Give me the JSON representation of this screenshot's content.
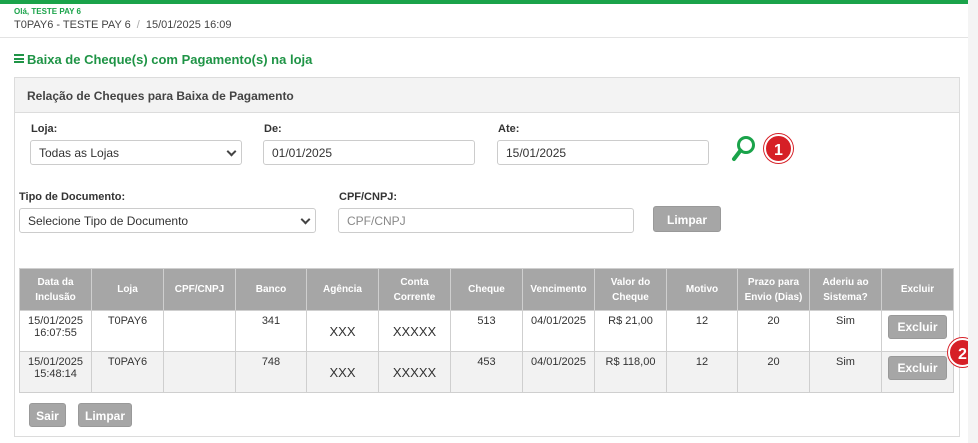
{
  "header": {
    "greeting": "Olá, TESTE PAY 6",
    "store": "T0PAY6 - TESTE PAY 6",
    "separator": "/",
    "datetime": "15/01/2025 16:09"
  },
  "page": {
    "title": "Baixa de Cheque(s) com Pagamento(s) na loja"
  },
  "panel": {
    "title": "Relação de Cheques para Baixa de Pagamento"
  },
  "filters": {
    "loja_label": "Loja:",
    "loja_value": "Todas as Lojas",
    "de_label": "De:",
    "de_value": "01/01/2025",
    "ate_label": "Ate:",
    "ate_value": "15/01/2025",
    "tipo_label": "Tipo de Documento:",
    "tipo_value": "Selecione Tipo de Documento",
    "cpf_label": "CPF/CNPJ:",
    "cpf_placeholder": "CPF/CNPJ",
    "limpar_label": "Limpar"
  },
  "badges": {
    "one": "1",
    "two": "2"
  },
  "table": {
    "headers": [
      "Data da Inclusão",
      "Loja",
      "CPF/CNPJ",
      "Banco",
      "Agência",
      "Conta Corrente",
      "Cheque",
      "Vencimento",
      "Valor do Cheque",
      "Motivo",
      "Prazo para Envio (Dias)",
      "Aderiu ao Sistema?",
      "Excluir"
    ],
    "rows": [
      {
        "data_inclusao": "15/01/2025 16:07:55",
        "loja": "T0PAY6",
        "cpf_cnpj": "",
        "banco": "341",
        "agencia": "XXX",
        "conta": "XXXXX",
        "cheque": "513",
        "vencimento": "04/01/2025",
        "valor": "R$ 21,00",
        "motivo": "12",
        "prazo": "20",
        "aderiu": "Sim",
        "excluir": "Excluir"
      },
      {
        "data_inclusao": "15/01/2025 15:48:14",
        "loja": "T0PAY6",
        "cpf_cnpj": "",
        "banco": "748",
        "agencia": "XXX",
        "conta": "XXXXX",
        "cheque": "453",
        "vencimento": "04/01/2025",
        "valor": "R$ 118,00",
        "motivo": "12",
        "prazo": "20",
        "aderiu": "Sim",
        "excluir": "Excluir"
      }
    ]
  },
  "footer": {
    "sair_label": "Sair",
    "limpar_label": "Limpar"
  },
  "colors": {
    "brand_green": "#1aa34a",
    "badge_red": "#d61f26",
    "button_gray": "#a6a6a6"
  }
}
